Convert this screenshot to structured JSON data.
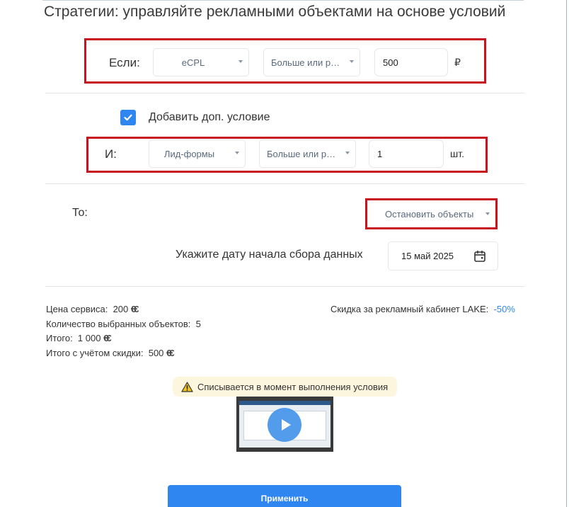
{
  "page_title": "Стратегии: управляйте рекламными объектами на основе условий",
  "condition_if": {
    "label": "Если:",
    "metric": "eCPL",
    "operator": "Больше или рав...",
    "value": "500",
    "unit": "₽"
  },
  "add_condition": {
    "checked": true,
    "label": "Добавить доп. условие"
  },
  "condition_and": {
    "label": "И:",
    "metric": "Лид-формы",
    "operator": "Больше или рав...",
    "value": "1",
    "unit": "шт."
  },
  "action": {
    "label": "То:",
    "value": "Остановить объекты"
  },
  "start_date": {
    "label": "Укажите дату начала сбора данных",
    "value": "15 май 2025"
  },
  "pricing": {
    "service_price_label": "Цена сервиса:",
    "service_price_value": "200",
    "objects_count_label": "Количество выбранных объектов:",
    "objects_count_value": "5",
    "total_label": "Итого:",
    "total_value": "1 000",
    "total_discount_label": "Итого с учётом скидки:",
    "total_discount_value": "500",
    "currency_symbol": "€€",
    "discount_label": "Скидка за рекламный кабинет LAKE:",
    "discount_value": "-50%"
  },
  "warning_text": "Списывается в момент выполнения условия",
  "apply_button": "Применить",
  "colors": {
    "accent": "#2f86f0",
    "highlight_border": "#c8141e",
    "warning_bg": "#fdf6df"
  }
}
